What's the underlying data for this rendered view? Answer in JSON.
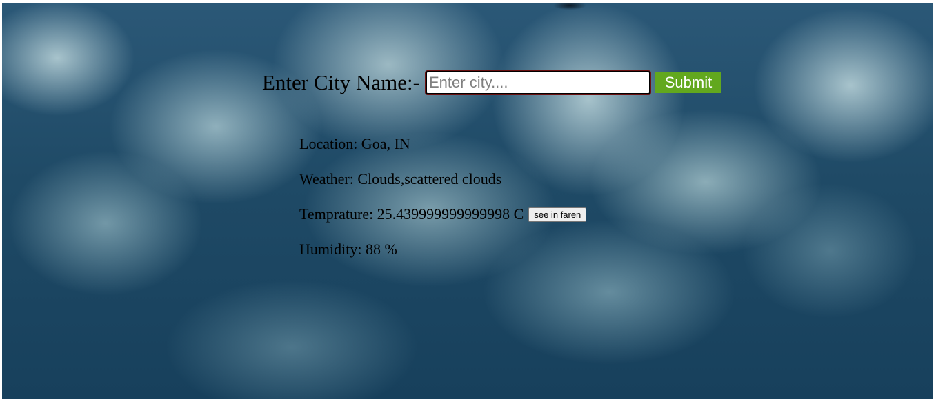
{
  "form": {
    "label": "Enter City Name:-",
    "input_placeholder": "Enter city....",
    "input_value": "",
    "submit_label": "Submit"
  },
  "results": {
    "location": "Location: Goa, IN",
    "weather": "Weather: Clouds,scattered clouds",
    "temperature": "Temprature: 25.439999999999998 C",
    "faren_button_label": "see in faren",
    "humidity": "Humidity: 88 %"
  },
  "colors": {
    "submit_bg": "#62a81e",
    "background": "#1f4a66"
  }
}
